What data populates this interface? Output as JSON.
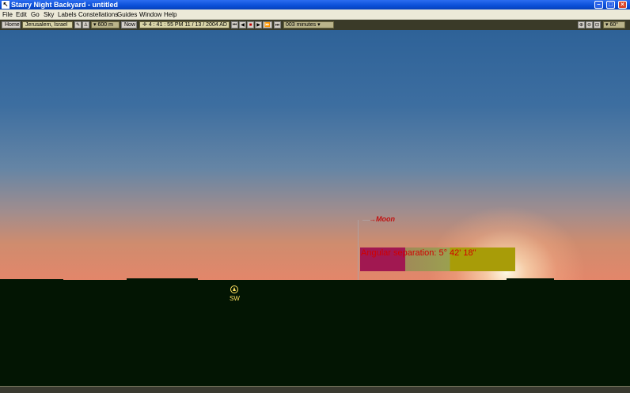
{
  "window": {
    "title": "Starry Night Backyard - untitled"
  },
  "menu": [
    "File",
    "Edit",
    "Go",
    "Sky",
    "Labels",
    "Constellations",
    "Guides",
    "Window",
    "Help"
  ],
  "toolbar": {
    "home_label": "Home",
    "location": "Jerusalem, Israel",
    "elevation": "▾ 600 m",
    "now_label": "Now",
    "time": "4 : 41 : 55  PM",
    "date": "11 / 13 / 2004  AD",
    "step": "003 minutes ▾",
    "fov": "▾ 60°"
  },
  "sky": {
    "moon_label": "Moon",
    "angular_separation": "Angular separation: 5° 42' 18\"",
    "compass_direction": "SW"
  },
  "colors": {
    "sky_top": "#2e6298",
    "horizon": "#e4866a",
    "ground": "#031503",
    "accent": "#c01010"
  }
}
